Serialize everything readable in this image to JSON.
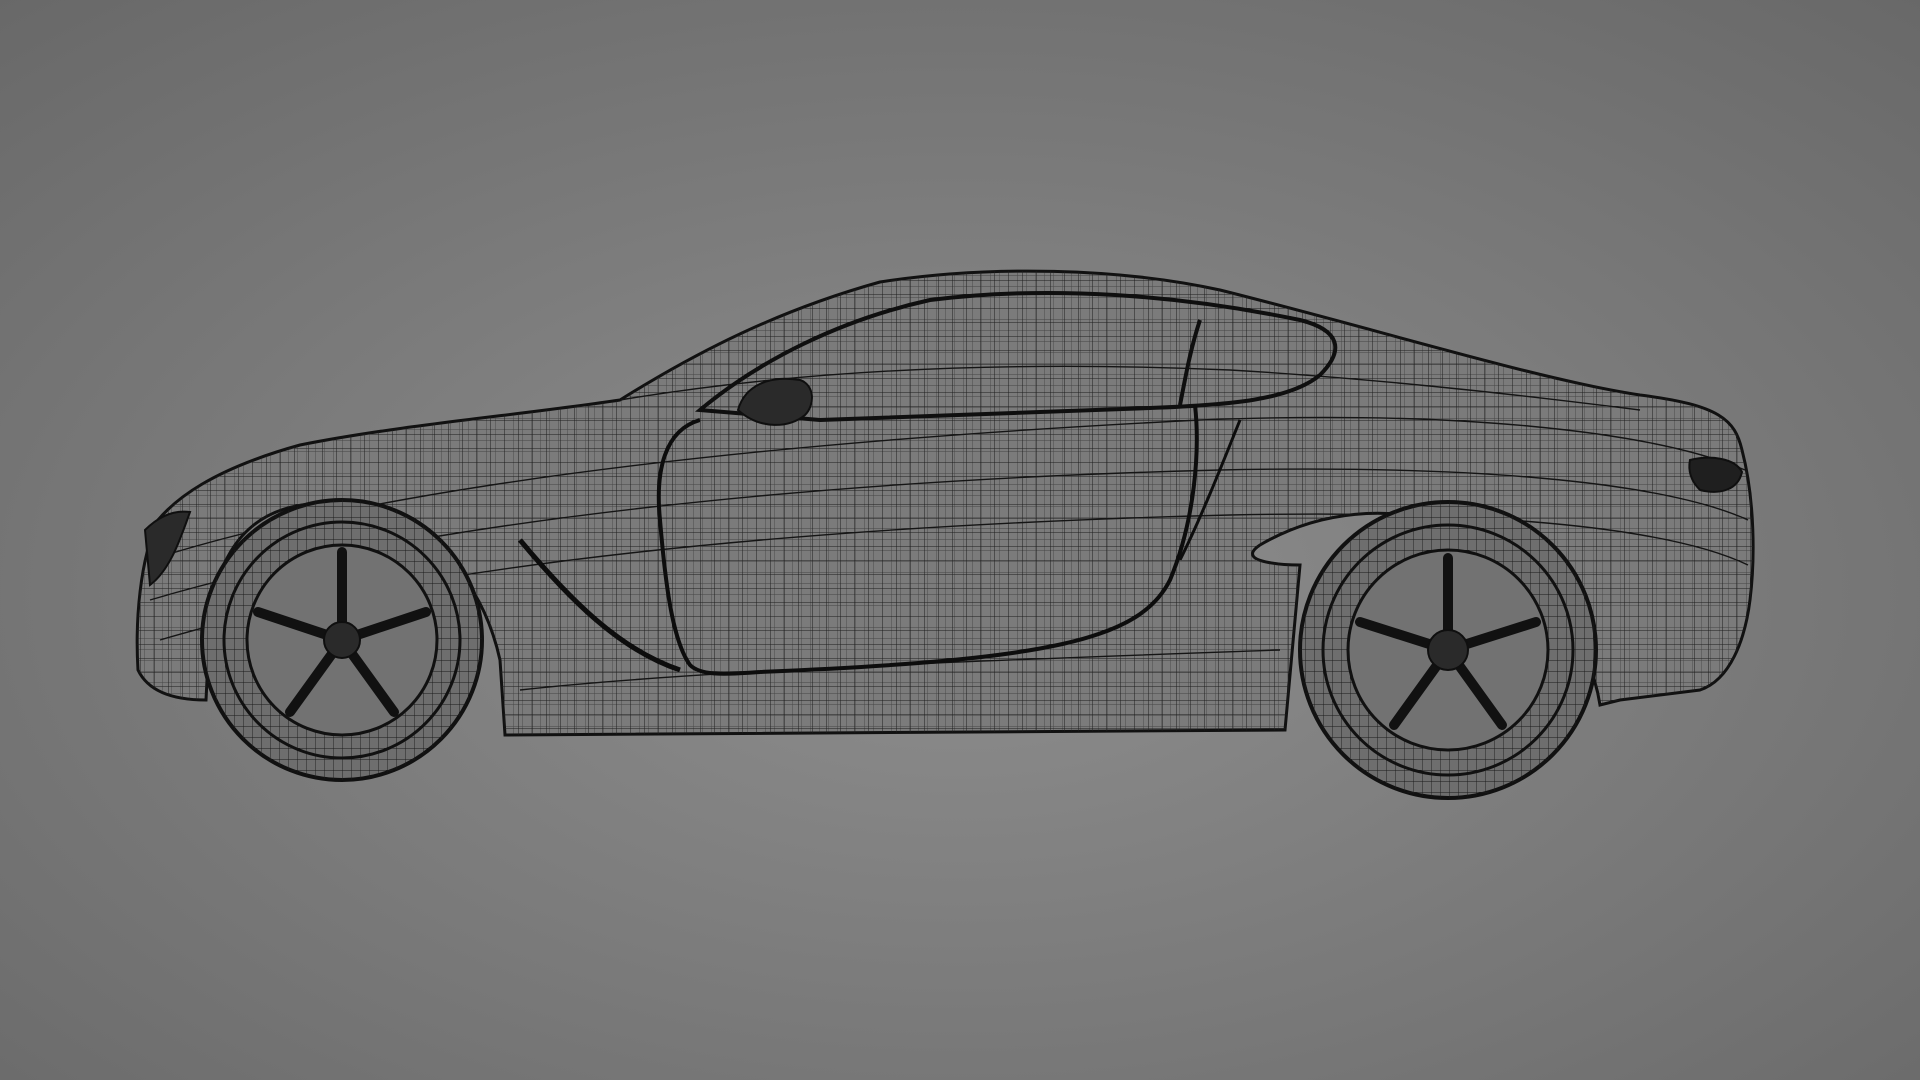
{
  "scene": {
    "subject": "car-wireframe",
    "view": "side",
    "render_mode": "wireframe"
  },
  "colors": {
    "background_center": "#8b8b8b",
    "background_edge": "#6a6a6a",
    "wire": "#1e1e1e",
    "wire_dense": "#121212",
    "body_shade": "#7a7a7a"
  }
}
